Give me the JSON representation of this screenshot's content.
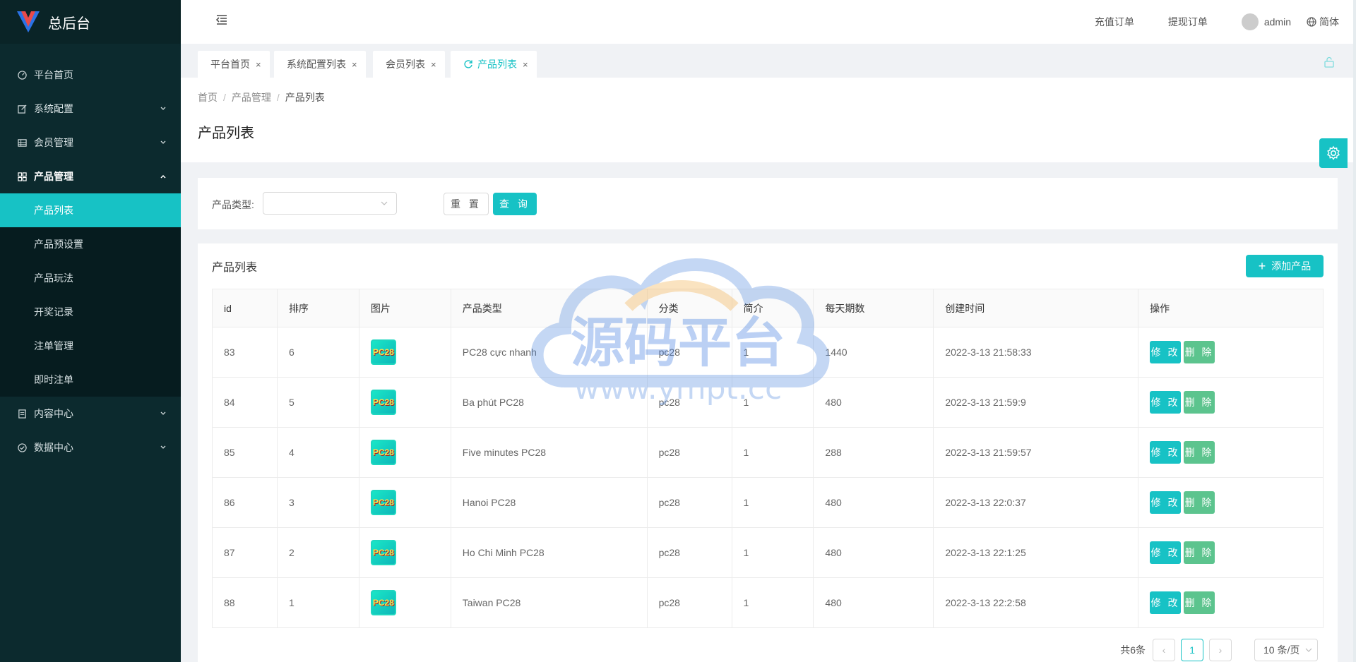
{
  "app": {
    "title": "总后台"
  },
  "colors": {
    "accent": "#17c2c5",
    "sidebar_bg": "#0c2a2e",
    "delete": "#5cc48e"
  },
  "sidebar": {
    "items": [
      {
        "label": "平台首页",
        "icon": "dashboard-icon"
      },
      {
        "label": "系统配置",
        "icon": "edit-icon",
        "has_children": true
      },
      {
        "label": "会员管理",
        "icon": "table-icon",
        "has_children": true
      },
      {
        "label": "产品管理",
        "icon": "grid-icon",
        "has_children": true,
        "expanded": true,
        "children": [
          {
            "label": "产品列表",
            "active": true
          },
          {
            "label": "产品预设置"
          },
          {
            "label": "产品玩法"
          },
          {
            "label": "开奖记录"
          },
          {
            "label": "注单管理"
          },
          {
            "label": "即时注单"
          }
        ]
      },
      {
        "label": "内容中心",
        "icon": "document-icon",
        "has_children": true
      },
      {
        "label": "数据中心",
        "icon": "check-circle-icon",
        "has_children": true
      }
    ]
  },
  "header": {
    "links": [
      "充值订单",
      "提现订单"
    ],
    "user": "admin",
    "language": "简体"
  },
  "tabs": [
    {
      "label": "平台首页"
    },
    {
      "label": "系统配置列表"
    },
    {
      "label": "会员列表"
    },
    {
      "label": "产品列表",
      "active": true
    }
  ],
  "breadcrumb": [
    "首页",
    "产品管理",
    "产品列表"
  ],
  "page_title": "产品列表",
  "filter": {
    "label": "产品类型:",
    "select_value": "",
    "reset_label": "重 置",
    "query_label": "查 询"
  },
  "table_card": {
    "title": "产品列表",
    "add_label": "添加产品",
    "columns": [
      "id",
      "排序",
      "图片",
      "产品类型",
      "分类",
      "简介",
      "每天期数",
      "创建时间",
      "操作"
    ],
    "edit_label": "修 改",
    "delete_label": "删 除",
    "rows": [
      {
        "id": "83",
        "sort": "6",
        "type": "PC28 cực nhanh",
        "category": "pc28",
        "intro": "1",
        "per_day": "1440",
        "created": "2022-3-13 21:58:33"
      },
      {
        "id": "84",
        "sort": "5",
        "type": "Ba phút PC28",
        "category": "pc28",
        "intro": "1",
        "per_day": "480",
        "created": "2022-3-13 21:59:9"
      },
      {
        "id": "85",
        "sort": "4",
        "type": "Five minutes PC28",
        "category": "pc28",
        "intro": "1",
        "per_day": "288",
        "created": "2022-3-13 21:59:57"
      },
      {
        "id": "86",
        "sort": "3",
        "type": "Hanoi PC28",
        "category": "pc28",
        "intro": "1",
        "per_day": "480",
        "created": "2022-3-13 22:0:37"
      },
      {
        "id": "87",
        "sort": "2",
        "type": "Ho Chi Minh PC28",
        "category": "pc28",
        "intro": "1",
        "per_day": "480",
        "created": "2022-3-13 22:1:25"
      },
      {
        "id": "88",
        "sort": "1",
        "type": "Taiwan PC28",
        "category": "pc28",
        "intro": "1",
        "per_day": "480",
        "created": "2022-3-13 22:2:58"
      }
    ],
    "thumb_text": "PC28"
  },
  "pagination": {
    "total": "共6条",
    "current": "1",
    "page_size": "10 条/页"
  },
  "watermark": {
    "title": "源码平台",
    "url": "www.ympt.cc"
  }
}
